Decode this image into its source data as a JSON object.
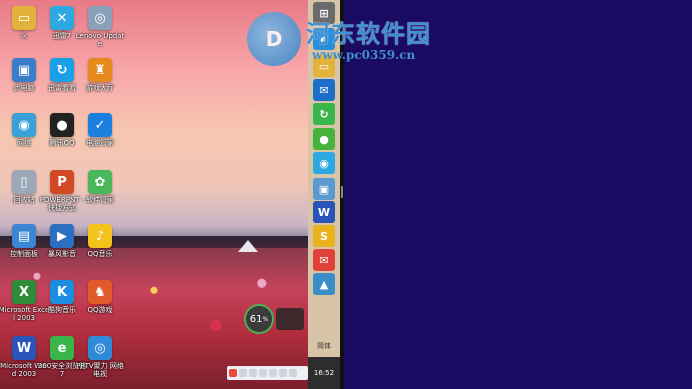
{
  "desktop_icons": [
    {
      "label": "lk",
      "color": "#e2b33a",
      "glyph": "▭"
    },
    {
      "label": "迅雷7",
      "color": "#2ea8e0",
      "glyph": "✕"
    },
    {
      "label": "Lenovo Update",
      "color": "#8aa0b8",
      "glyph": "◎"
    },
    {
      "label": "此电脑",
      "color": "#3a7ec8",
      "glyph": "▣"
    },
    {
      "label": "迅雷看看",
      "color": "#1aa0e8",
      "glyph": "↻"
    },
    {
      "label": "游戏大厅",
      "color": "#e68a1c",
      "glyph": "♜"
    },
    {
      "label": "网络",
      "color": "#3aa0d8",
      "glyph": "◉"
    },
    {
      "label": "腾讯QQ",
      "color": "#222222",
      "glyph": "●"
    },
    {
      "label": "电脑管家",
      "color": "#1b7fe0",
      "glyph": "✓"
    },
    {
      "label": "回收站",
      "color": "#9aa8b8",
      "glyph": "▯"
    },
    {
      "label": "POWERPNT - 快捷方式",
      "color": "#d24a25",
      "glyph": "P"
    },
    {
      "label": "软件管家",
      "color": "#4ab85a",
      "glyph": "✿"
    },
    {
      "label": "控制面板",
      "color": "#3a86d0",
      "glyph": "▤"
    },
    {
      "label": "暴风影音",
      "color": "#2a6fc0",
      "glyph": "▶"
    },
    {
      "label": "QQ音乐",
      "color": "#f3c21c",
      "glyph": "♪"
    },
    {
      "label": "Microsoft Excel 2003",
      "color": "#2f8a3a",
      "glyph": "X"
    },
    {
      "label": "酷狗音乐",
      "color": "#1b8ee0",
      "glyph": "K"
    },
    {
      "label": "QQ游戏",
      "color": "#e05a2a",
      "glyph": "♞"
    },
    {
      "label": "Microsoft Word 2003",
      "color": "#2a55b8",
      "glyph": "W"
    },
    {
      "label": "360安全浏览器7",
      "color": "#3ab54a",
      "glyph": "e"
    },
    {
      "label": "PPTV聚力 网络电视",
      "color": "#2f8ad8",
      "glyph": "◎"
    }
  ],
  "gauge": {
    "value": "61",
    "unit": "%"
  },
  "charms": [
    {
      "name": "windows-start",
      "color": "#6b6b6b",
      "glyph": "⊞"
    },
    {
      "name": "ie",
      "color": "#2a8fd8",
      "glyph": "e"
    },
    {
      "name": "folder",
      "color": "#e2b33a",
      "glyph": "▭"
    },
    {
      "name": "mail",
      "color": "#1b6fc8",
      "glyph": "✉"
    },
    {
      "name": "360",
      "color": "#3ab54a",
      "glyph": "↻"
    },
    {
      "name": "bomb",
      "color": "#46b43c",
      "glyph": "●"
    },
    {
      "name": "qq-browser",
      "color": "#2ea8e0",
      "glyph": "◉"
    },
    {
      "name": "network",
      "color": "#5a9ad0",
      "glyph": "▣"
    },
    {
      "name": "word",
      "color": "#2a55b8",
      "glyph": "W"
    },
    {
      "name": "wps",
      "color": "#e8b21c",
      "glyph": "S"
    },
    {
      "name": "mail-red",
      "color": "#e0403a",
      "glyph": "✉"
    },
    {
      "name": "photos",
      "color": "#3a8ec8",
      "glyph": "▲"
    }
  ],
  "tray": {
    "ime": "简体",
    "clock": "16:52"
  },
  "watermark": {
    "logo": "D",
    "title": "河东软件园",
    "url": "www.pc0359.cn"
  }
}
